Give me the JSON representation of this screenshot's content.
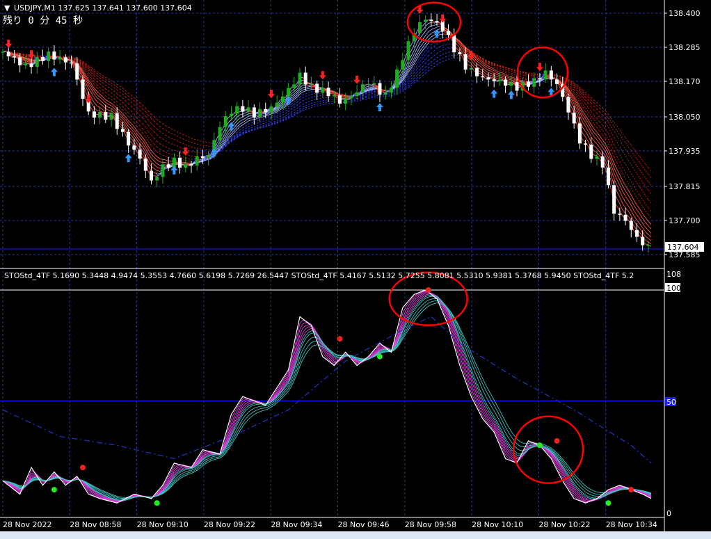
{
  "header": {
    "symbol_line": "USDJPY,M1  137.625 137.641 137.600 137.604",
    "timer_text": "残り 0 分 45 秒"
  },
  "indicator": {
    "legend": "STOStd_4TF 5.1690 5.3448 4.9474 5.3553 4.7660 5.6198 5.7269 26.5447   STOStd_4TF 5.4167 5.5132 5.7255 5.8081 5.5310 5.9381 5.3768 5.9450   STOStd_4TF 5.2",
    "scale_top": "108",
    "scale_100": "100",
    "level_mid": "50",
    "scale_bottom": "0"
  },
  "colors": {
    "background": "#000000",
    "grid": "#2b3a8a",
    "bull": "#22aa22",
    "bear": "#ffffff",
    "marker_up": "#3399ff",
    "marker_down": "#ff2222",
    "level_line": "#1a1aff",
    "circle": "#ff0000"
  },
  "chart_data": [
    {
      "type": "candlestick",
      "symbol": "USDJPY",
      "timeframe": "M1",
      "y_ticks": [
        "138.400",
        "138.285",
        "138.170",
        "138.050",
        "137.935",
        "137.815",
        "137.700",
        "137.585"
      ],
      "ylim": [
        137.57,
        138.435
      ],
      "current_price_label": "137.604",
      "current_price": 137.604,
      "close_path": [
        [
          0,
          138.27
        ],
        [
          8,
          138.22
        ],
        [
          16,
          138.26
        ],
        [
          24,
          138.23
        ],
        [
          30,
          138.06
        ],
        [
          38,
          138.05
        ],
        [
          44,
          137.96
        ],
        [
          48,
          137.91
        ],
        [
          52,
          137.83
        ],
        [
          56,
          137.88
        ],
        [
          60,
          137.9
        ],
        [
          64,
          137.88
        ],
        [
          68,
          137.91
        ],
        [
          72,
          137.92
        ],
        [
          76,
          138.02
        ],
        [
          80,
          138.07
        ],
        [
          84,
          138.08
        ],
        [
          88,
          138.06
        ],
        [
          94,
          138.08
        ],
        [
          98,
          138.12
        ],
        [
          104,
          138.19
        ],
        [
          108,
          138.15
        ],
        [
          114,
          138.13
        ],
        [
          118,
          138.1
        ],
        [
          122,
          138.12
        ],
        [
          128,
          138.17
        ],
        [
          134,
          138.12
        ],
        [
          138,
          138.2
        ],
        [
          142,
          138.3
        ],
        [
          146,
          138.37
        ],
        [
          150,
          138.38
        ],
        [
          154,
          138.35
        ],
        [
          158,
          138.28
        ],
        [
          162,
          138.22
        ],
        [
          168,
          138.18
        ],
        [
          174,
          138.17
        ],
        [
          180,
          138.15
        ],
        [
          186,
          138.17
        ],
        [
          190,
          138.2
        ],
        [
          194,
          138.16
        ],
        [
          198,
          138.07
        ],
        [
          202,
          137.97
        ],
        [
          206,
          137.92
        ],
        [
          210,
          137.89
        ],
        [
          214,
          137.73
        ],
        [
          218,
          137.7
        ],
        [
          222,
          137.64
        ],
        [
          227,
          137.6
        ]
      ],
      "x_tick_labels": [
        "28 Nov 2022",
        "28 Nov 08:58",
        "28 Nov 09:10",
        "28 Nov 09:22",
        "28 Nov 09:34",
        "28 Nov 09:46",
        "28 Nov 09:58",
        "28 Nov 10:10",
        "28 Nov 10:22",
        "28 Nov 10:34"
      ],
      "grid": true
    },
    {
      "type": "line",
      "indicator": "STOStd_4TF",
      "ylim": [
        0,
        108
      ],
      "levels": [
        50,
        100
      ],
      "main_path": [
        [
          0,
          14
        ],
        [
          6,
          8
        ],
        [
          10,
          20
        ],
        [
          14,
          12
        ],
        [
          18,
          18
        ],
        [
          22,
          12
        ],
        [
          26,
          16
        ],
        [
          30,
          8
        ],
        [
          34,
          6
        ],
        [
          40,
          4
        ],
        [
          46,
          8
        ],
        [
          52,
          6
        ],
        [
          56,
          12
        ],
        [
          60,
          22
        ],
        [
          66,
          20
        ],
        [
          70,
          28
        ],
        [
          76,
          26
        ],
        [
          80,
          44
        ],
        [
          84,
          52
        ],
        [
          88,
          50
        ],
        [
          92,
          48
        ],
        [
          96,
          56
        ],
        [
          100,
          64
        ],
        [
          104,
          88
        ],
        [
          108,
          84
        ],
        [
          112,
          70
        ],
        [
          116,
          66
        ],
        [
          120,
          72
        ],
        [
          124,
          66
        ],
        [
          128,
          70
        ],
        [
          132,
          76
        ],
        [
          136,
          72
        ],
        [
          140,
          92
        ],
        [
          144,
          98
        ],
        [
          148,
          100
        ],
        [
          152,
          96
        ],
        [
          156,
          84
        ],
        [
          160,
          66
        ],
        [
          164,
          52
        ],
        [
          168,
          42
        ],
        [
          172,
          36
        ],
        [
          176,
          24
        ],
        [
          180,
          22
        ],
        [
          184,
          32
        ],
        [
          188,
          30
        ],
        [
          192,
          24
        ],
        [
          196,
          14
        ],
        [
          200,
          6
        ],
        [
          204,
          4
        ],
        [
          208,
          6
        ],
        [
          212,
          10
        ],
        [
          216,
          12
        ],
        [
          220,
          10
        ],
        [
          224,
          8
        ],
        [
          227,
          6
        ]
      ],
      "signal_path": [
        [
          0,
          46
        ],
        [
          20,
          34
        ],
        [
          40,
          30
        ],
        [
          60,
          24
        ],
        [
          80,
          34
        ],
        [
          100,
          46
        ],
        [
          120,
          68
        ],
        [
          140,
          82
        ],
        [
          150,
          88
        ],
        [
          160,
          76
        ],
        [
          180,
          60
        ],
        [
          200,
          46
        ],
        [
          220,
          30
        ],
        [
          227,
          22
        ]
      ],
      "markers_green": [
        [
          18,
          10
        ],
        [
          54,
          4
        ],
        [
          132,
          70
        ],
        [
          188,
          30
        ],
        [
          212,
          4
        ]
      ],
      "markers_red": [
        [
          28,
          20
        ],
        [
          118,
          78
        ],
        [
          149,
          100
        ],
        [
          194,
          32
        ],
        [
          220,
          10
        ]
      ]
    }
  ]
}
